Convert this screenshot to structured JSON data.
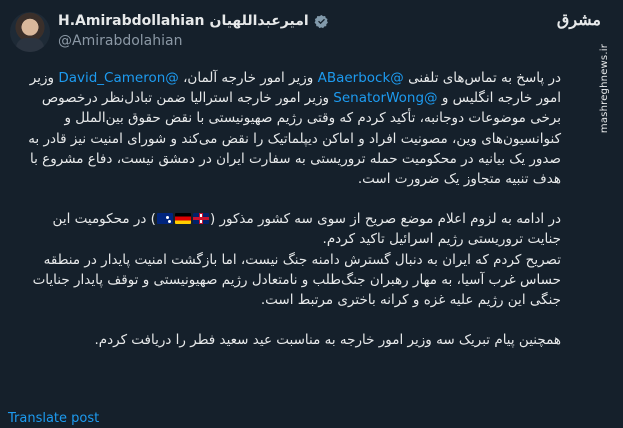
{
  "author": {
    "display_name": "H.Amirabdollahian",
    "display_name_fa": "امیرعبداللهیان",
    "handle": "@Amirabdolahian"
  },
  "watermark": {
    "brand": "مشرق",
    "url": "mashreghnews.ir"
  },
  "tweet": {
    "p1": {
      "s1": "در پاسخ به تماس‌های تلفنی ",
      "m1": "@ABaerbock",
      "s2": " وزیر امور خارجه آلمان، ",
      "m2": "@David_Cameron",
      "s3": " وزیر امور خارجه انگلیس و ",
      "m3": "@SenatorWong",
      "s4": " وزیر امور خارجه استرالیا ضمن تبادل‌نظر درخصوص برخی موضوعات دوجانبه، تأکید کردم که وقتی رژیم صهیونیستی با نقض حقوق بین‌الملل و کنوانسیون‌های وین، مصونیت افراد و اماکن دیپلماتیک را نقض می‌کند و شورای امنیت نیز قادر به صدور یک بیانیه در محکومیت حمله تروریستی به سفارت ایران در دمشق نیست، دفاع مشروع با هدف تنبیه متجاوز یک ضرورت است."
    },
    "p2": {
      "s1": "در ادامه به لزوم اعلام موضع صریح از سوی سه کشور مذکور (",
      "s2": ") در محکومیت این جنایت تروریستی رژیم اسرائیل تاکید کردم."
    },
    "p3": "تصریح کردم که ایران به دنبال گسترش دامنه جنگ نیست، اما بازگشت امنیت پایدار در منطقه حساس غرب آسیا، به مهار رهبران جنگ‌طلب و نامتعادل رژیم صهیونیستی و توقف پایدار جنایات جنگی این رژیم علیه غزه و کرانه باختری مرتبط است.",
    "p4": "همچنین پیام تبریک سه وزیر امور خارجه به مناسبت عید سعید فطر را دریافت کردم."
  },
  "flags": [
    "flag-gb-icon",
    "flag-de-icon",
    "flag-au-icon"
  ],
  "actions": {
    "translate_label": "Translate post"
  },
  "colors": {
    "background": "#15202b",
    "text": "#e7e9ea",
    "secondary": "#8b98a5",
    "link": "#1d9bf0"
  }
}
